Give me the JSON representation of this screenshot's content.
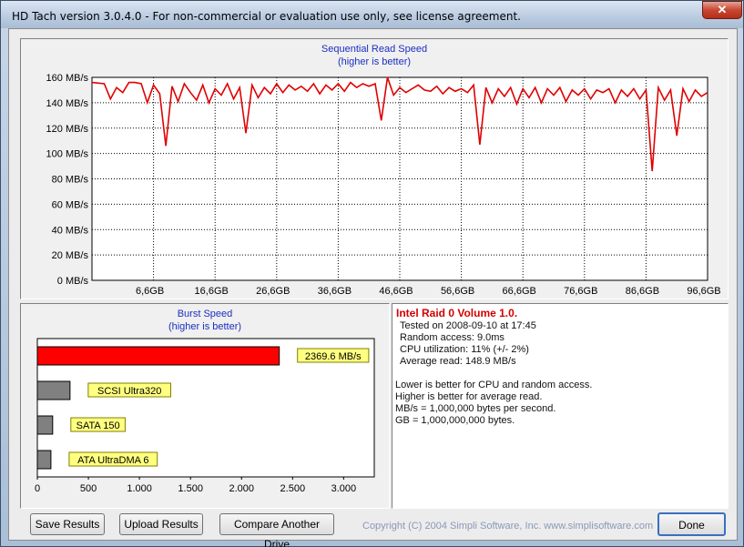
{
  "window": {
    "title": "HD Tach version 3.0.4.0  - For non-commercial or evaluation use only, see license agreement.",
    "close_label": "✕"
  },
  "read_chart": {
    "title": "Sequential Read Speed",
    "subtitle": "(higher is better)"
  },
  "burst_chart": {
    "title": "Burst Speed",
    "subtitle": "(higher is better)"
  },
  "chart_data": [
    {
      "type": "line",
      "title": "Sequential Read Speed",
      "subtitle": "(higher is better)",
      "y_ticks": [
        "0 MB/s",
        "20 MB/s",
        "40 MB/s",
        "60 MB/s",
        "80 MB/s",
        "100 MB/s",
        "120 MB/s",
        "140 MB/s",
        "160 MB/s"
      ],
      "x_ticks": [
        "6,6GB",
        "16,6GB",
        "26,6GB",
        "36,6GB",
        "46,6GB",
        "56,6GB",
        "66,6GB",
        "76,6GB",
        "86,6GB",
        "96,6GB"
      ],
      "ylim": [
        0,
        160
      ],
      "xlim": [
        0,
        100
      ],
      "grid": true,
      "series": [
        {
          "color": "#e00000",
          "x": [
            0,
            2,
            3,
            4,
            5,
            6,
            7,
            8,
            9,
            10,
            11,
            12,
            13,
            14,
            15,
            16,
            17,
            18,
            19,
            20,
            21,
            22,
            23,
            24,
            25,
            26,
            27,
            28,
            29,
            30,
            31,
            32,
            33,
            34,
            35,
            36,
            37,
            38,
            39,
            40,
            41,
            42,
            43,
            44,
            45,
            46,
            47,
            48,
            49,
            50,
            51,
            52,
            53,
            54,
            55,
            56,
            57,
            58,
            59,
            60,
            61,
            62,
            63,
            64,
            65,
            66,
            67,
            68,
            69,
            70,
            71,
            72,
            73,
            74,
            75,
            76,
            77,
            78,
            79,
            80,
            81,
            82,
            83,
            84,
            85,
            86,
            87,
            88,
            89,
            90,
            91,
            92,
            93,
            94,
            95,
            96,
            97,
            98,
            99,
            100
          ],
          "y": [
            156,
            155,
            143,
            152,
            148,
            156,
            156,
            155,
            140,
            154,
            147,
            106,
            153,
            141,
            155,
            148,
            142,
            154,
            140,
            151,
            146,
            155,
            143,
            152,
            116,
            154,
            144,
            152,
            147,
            155,
            148,
            154,
            150,
            153,
            149,
            155,
            147,
            154,
            150,
            155,
            149,
            156,
            152,
            155,
            153,
            155,
            126,
            160,
            146,
            152,
            148,
            151,
            154,
            150,
            149,
            153,
            147,
            152,
            149,
            151,
            148,
            154,
            107,
            152,
            140,
            151,
            145,
            152,
            139,
            151,
            144,
            152,
            140,
            151,
            146,
            152,
            141,
            150,
            146,
            151,
            143,
            150,
            148,
            151,
            140,
            150,
            145,
            151,
            143,
            150,
            86,
            152,
            142,
            150,
            114,
            151,
            141,
            150,
            145,
            148
          ]
        }
      ]
    },
    {
      "type": "bar",
      "orientation": "horizontal",
      "title": "Burst Speed",
      "subtitle": "(higher is better)",
      "x_ticks": [
        "0",
        "500",
        "1.000",
        "1.500",
        "2.000",
        "2.500",
        "3.000"
      ],
      "xlim": [
        0,
        3300
      ],
      "categories": [
        "2369.6 MB/s",
        "SCSI Ultra320",
        "SATA 150",
        "ATA UltraDMA 6"
      ],
      "values": [
        2369.6,
        320,
        150,
        133
      ],
      "colors": [
        "#ff0000",
        "#808080",
        "#808080",
        "#808080"
      ]
    }
  ],
  "info": {
    "title": "Intel Raid 0 Volume 1.0.",
    "lines": [
      "Tested on 2008-09-10 at 17:45",
      "Random access: 9.0ms",
      "CPU utilization: 11% (+/- 2%)",
      "Average read: 148.9 MB/s"
    ],
    "notes": [
      "Lower is better for CPU and random access.",
      "Higher is better for average read.",
      "MB/s = 1,000,000 bytes per second.",
      "GB = 1,000,000,000 bytes."
    ]
  },
  "buttons": {
    "save": "Save Results",
    "upload": "Upload Results",
    "compare": "Compare Another Drive",
    "done": "Done"
  },
  "footer": {
    "copyright": "Copyright (C) 2004 Simpli Software, Inc. www.simplisoftware.com"
  }
}
